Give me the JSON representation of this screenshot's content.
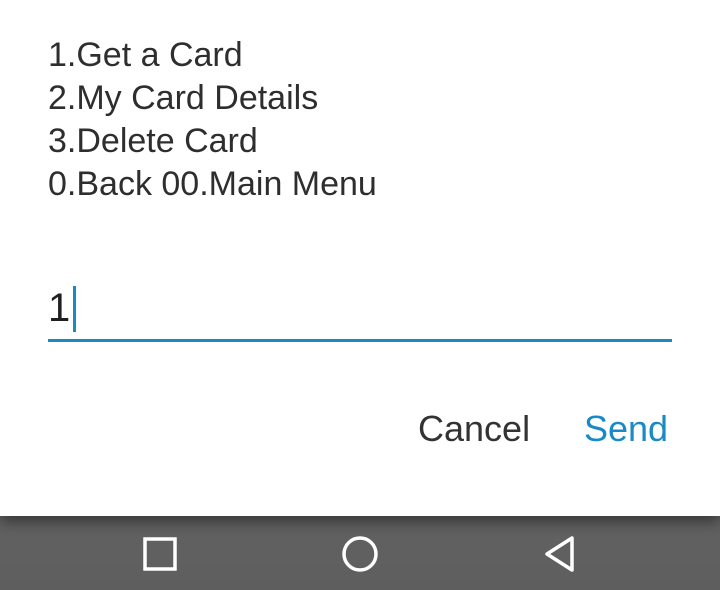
{
  "dialog": {
    "menu_lines": [
      "1.Get a Card",
      "2.My Card Details",
      "3.Delete Card",
      "0.Back 00.Main Menu"
    ],
    "input": {
      "value": "1"
    },
    "buttons": {
      "cancel_label": "Cancel",
      "send_label": "Send"
    },
    "colors": {
      "accent": "#1a8ac6",
      "text": "#2e2e2e",
      "background": "#ffffff"
    }
  },
  "navbar": {
    "icons": [
      "recents-icon",
      "home-icon",
      "back-icon"
    ]
  }
}
